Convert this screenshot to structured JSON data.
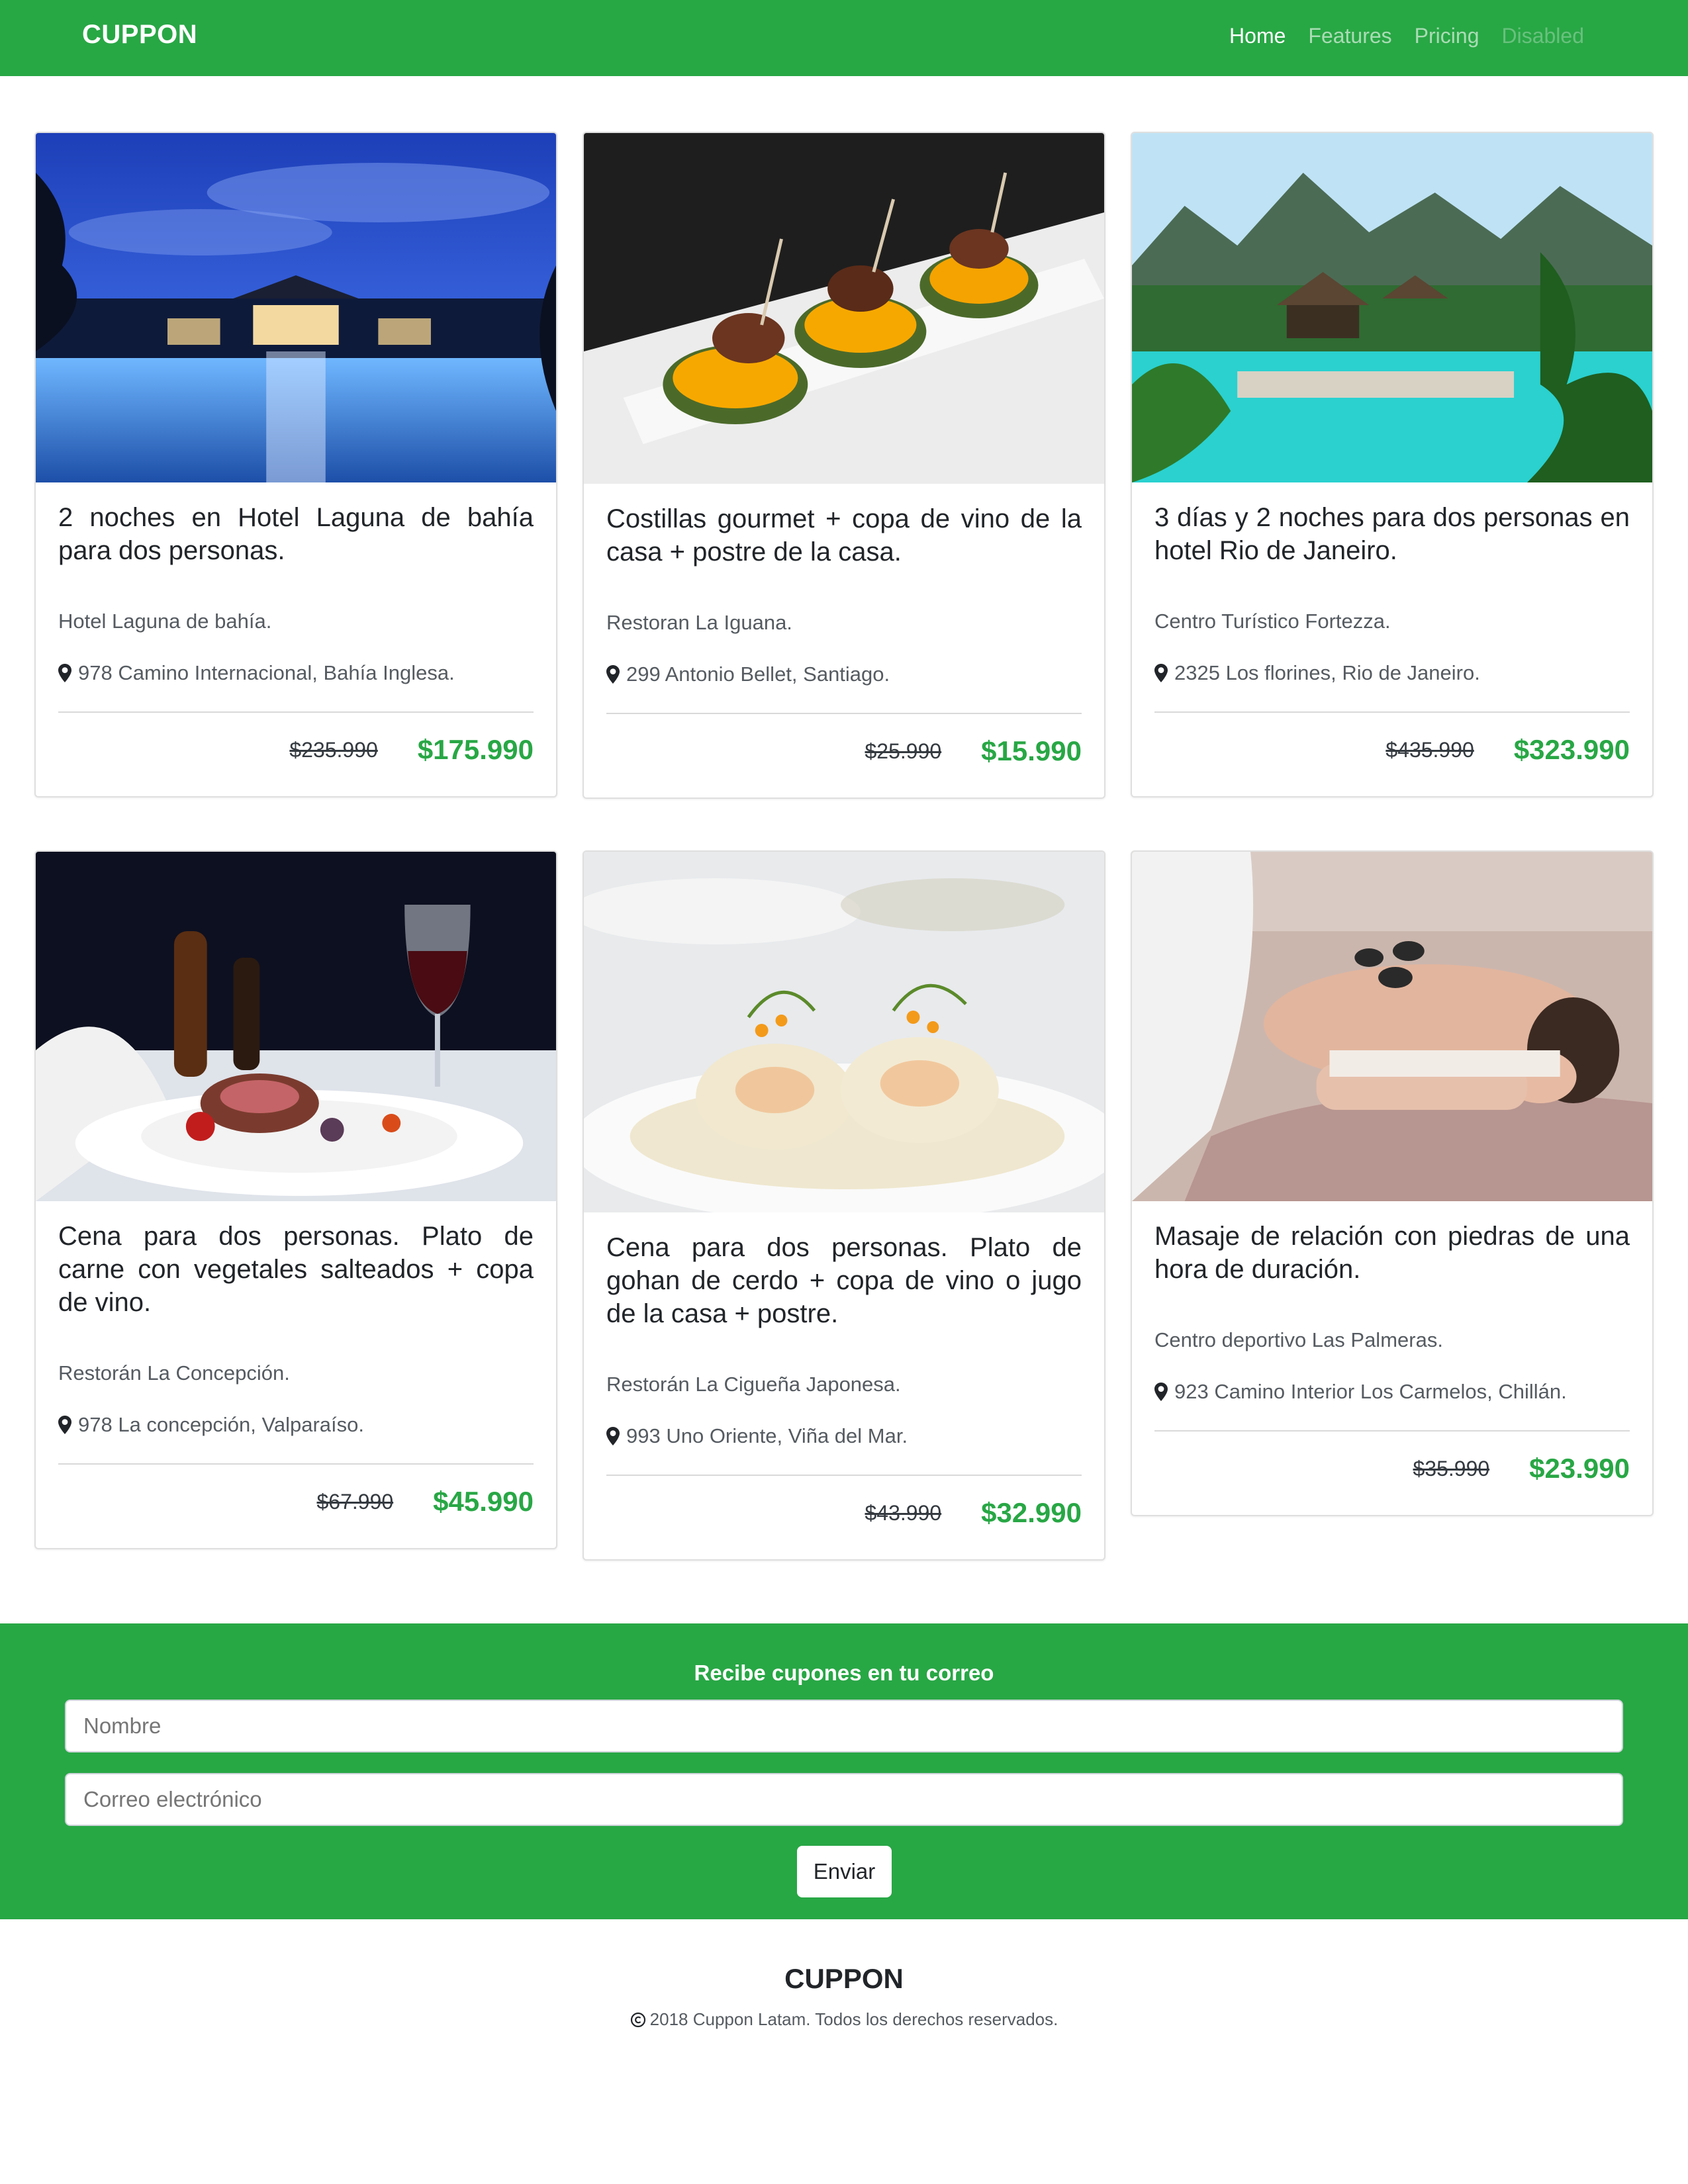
{
  "navbar": {
    "brand": "CUPPON",
    "links": [
      {
        "label": "Home",
        "state": "active"
      },
      {
        "label": "Features",
        "state": "normal"
      },
      {
        "label": "Pricing",
        "state": "normal"
      },
      {
        "label": "Disabled",
        "state": "disabled"
      }
    ]
  },
  "deals": [
    {
      "title": "2 noches en Hotel Laguna de bahía para dos personas.",
      "place": "Hotel Laguna de bahía.",
      "address": "978 Camino Internacional, Bahía Inglesa.",
      "old_price": "$235.990",
      "new_price": "$175.990",
      "image": "hotel-pool-night"
    },
    {
      "title": "Costillas gourmet + copa de vino de la casa + postre de la casa.",
      "place": "Restoran La Iguana.",
      "address": "299 Antonio Bellet, Santiago.",
      "old_price": "$25.990",
      "new_price": "$15.990",
      "image": "gourmet-ribs"
    },
    {
      "title": "3 días y 2 noches para dos personas en hotel Rio de Janeiro.",
      "place": "Centro Turístico Fortezza.",
      "address": "2325 Los florines, Rio de Janeiro.",
      "old_price": "$435.990",
      "new_price": "$323.990",
      "image": "tropical-resort-pool"
    },
    {
      "title": "Cena para dos personas. Plato de carne con vegetales salteados + copa de vino.",
      "place": "Restorán La Concepción.",
      "address": "978 La concepción, Valparaíso.",
      "old_price": "$67.990",
      "new_price": "$45.990",
      "image": "steak-dinner-wine"
    },
    {
      "title": "Cena para dos personas. Plato de gohan de cerdo + copa de vino o jugo de la casa + postre.",
      "place": "Restorán La Cigueña Japonesa.",
      "address": "993 Uno Oriente, Viña del Mar.",
      "old_price": "$43.990",
      "new_price": "$32.990",
      "image": "rolled-pork-dish"
    },
    {
      "title": "Masaje de relación con piedras de una hora de duración.",
      "place": "Centro deportivo Las Palmeras.",
      "address": "923 Camino Interior Los Carmelos, Chillán.",
      "old_price": "$35.990",
      "new_price": "$23.990",
      "image": "hot-stone-massage"
    }
  ],
  "newsletter": {
    "title": "Recibe cupones en tu correo",
    "name_placeholder": "Nombre",
    "email_placeholder": "Correo electrónico",
    "submit_label": "Enviar"
  },
  "footer": {
    "brand": "CUPPON",
    "copyright": "2018 Cuppon Latam. Todos los derechos reservados."
  },
  "colors": {
    "accent": "#28a745",
    "text": "#212529",
    "muted": "#555b61"
  }
}
